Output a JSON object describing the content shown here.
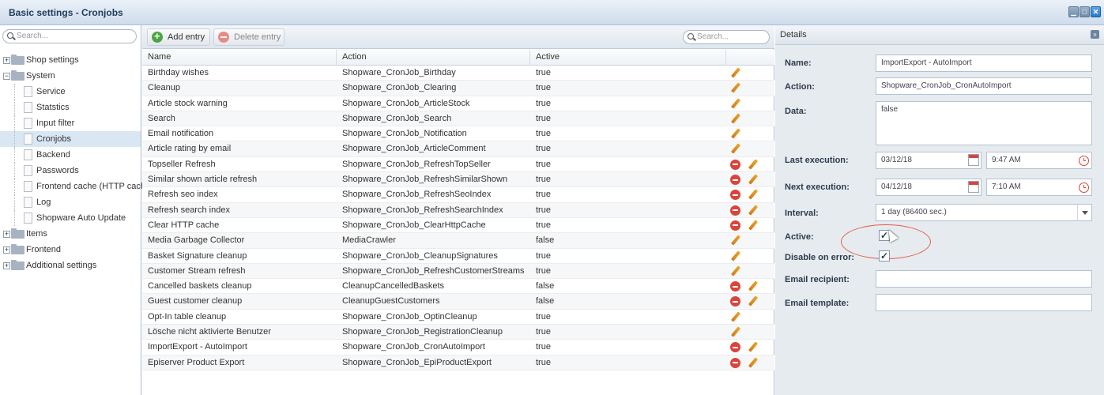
{
  "window": {
    "title": "Basic settings - Cronjobs"
  },
  "tree": {
    "search_placeholder": "Search...",
    "items": [
      {
        "label": "Shop settings",
        "type": "folder",
        "expander": "+"
      },
      {
        "label": "System",
        "type": "folder",
        "expander": "-"
      },
      {
        "label": "Service",
        "type": "file"
      },
      {
        "label": "Statstics",
        "type": "file"
      },
      {
        "label": "Input filter",
        "type": "file"
      },
      {
        "label": "Cronjobs",
        "type": "file",
        "selected": true
      },
      {
        "label": "Backend",
        "type": "file"
      },
      {
        "label": "Passwords",
        "type": "file"
      },
      {
        "label": "Frontend cache (HTTP cache)",
        "type": "file"
      },
      {
        "label": "Log",
        "type": "file"
      },
      {
        "label": "Shopware Auto Update",
        "type": "file"
      },
      {
        "label": "Items",
        "type": "folder",
        "expander": "+"
      },
      {
        "label": "Frontend",
        "type": "folder",
        "expander": "+"
      },
      {
        "label": "Additional settings",
        "type": "folder",
        "expander": "+"
      }
    ]
  },
  "toolbar": {
    "add_label": "Add entry",
    "delete_label": "Delete entry",
    "search_placeholder": "Search..."
  },
  "grid": {
    "columns": [
      "Name",
      "Action",
      "Active"
    ],
    "rows": [
      {
        "name": "Birthday wishes",
        "action": "Shopware_CronJob_Birthday",
        "active": "true",
        "deletable": false
      },
      {
        "name": "Cleanup",
        "action": "Shopware_CronJob_Clearing",
        "active": "true",
        "deletable": false
      },
      {
        "name": "Article stock warning",
        "action": "Shopware_CronJob_ArticleStock",
        "active": "true",
        "deletable": false
      },
      {
        "name": "Search",
        "action": "Shopware_CronJob_Search",
        "active": "true",
        "deletable": false
      },
      {
        "name": "Email notification",
        "action": "Shopware_CronJob_Notification",
        "active": "true",
        "deletable": false
      },
      {
        "name": "Article rating by email",
        "action": "Shopware_CronJob_ArticleComment",
        "active": "true",
        "deletable": false
      },
      {
        "name": "Topseller Refresh",
        "action": "Shopware_CronJob_RefreshTopSeller",
        "active": "true",
        "deletable": true
      },
      {
        "name": "Similar shown article refresh",
        "action": "Shopware_CronJob_RefreshSimilarShown",
        "active": "true",
        "deletable": true
      },
      {
        "name": "Refresh seo index",
        "action": "Shopware_CronJob_RefreshSeoIndex",
        "active": "true",
        "deletable": true
      },
      {
        "name": "Refresh search index",
        "action": "Shopware_CronJob_RefreshSearchIndex",
        "active": "true",
        "deletable": true
      },
      {
        "name": "Clear HTTP cache",
        "action": "Shopware_CronJob_ClearHttpCache",
        "active": "true",
        "deletable": true
      },
      {
        "name": "Media Garbage Collector",
        "action": "MediaCrawler",
        "active": "false",
        "deletable": false
      },
      {
        "name": "Basket Signature cleanup",
        "action": "Shopware_CronJob_CleanupSignatures",
        "active": "true",
        "deletable": false
      },
      {
        "name": "Customer Stream refresh",
        "action": "Shopware_CronJob_RefreshCustomerStreams",
        "active": "true",
        "deletable": false
      },
      {
        "name": "Cancelled baskets cleanup",
        "action": "CleanupCancelledBaskets",
        "active": "false",
        "deletable": true
      },
      {
        "name": "Guest customer cleanup",
        "action": "CleanupGuestCustomers",
        "active": "false",
        "deletable": true
      },
      {
        "name": "Opt-In table cleanup",
        "action": "Shopware_CronJob_OptinCleanup",
        "active": "true",
        "deletable": false
      },
      {
        "name": "Lösche nicht aktivierte Benutzer",
        "action": "Shopware_CronJob_RegistrationCleanup",
        "active": "true",
        "deletable": false
      },
      {
        "name": "ImportExport - AutoImport",
        "action": "Shopware_CronJob_CronAutoImport",
        "active": "true",
        "deletable": true
      },
      {
        "name": "Episerver Product Export",
        "action": "Shopware_CronJob_EpiProductExport",
        "active": "true",
        "deletable": true
      }
    ]
  },
  "details": {
    "title": "Details",
    "name_label": "Name:",
    "name_value": "ImportExport - AutoImport",
    "action_label": "Action:",
    "action_value": "Shopware_CronJob_CronAutoImport",
    "data_label": "Data:",
    "data_value": "false",
    "last_label": "Last execution:",
    "last_date": "03/12/18",
    "last_time": "9:47 AM",
    "next_label": "Next execution:",
    "next_date": "04/12/18",
    "next_time": "7:10 AM",
    "interval_label": "Interval:",
    "interval_value": "1 day (86400 sec.)",
    "active_label": "Active:",
    "active_checked": true,
    "disable_label": "Disable on error:",
    "disable_checked": true,
    "recipient_label": "Email recipient:",
    "recipient_value": "",
    "template_label": "Email template:",
    "template_value": ""
  }
}
